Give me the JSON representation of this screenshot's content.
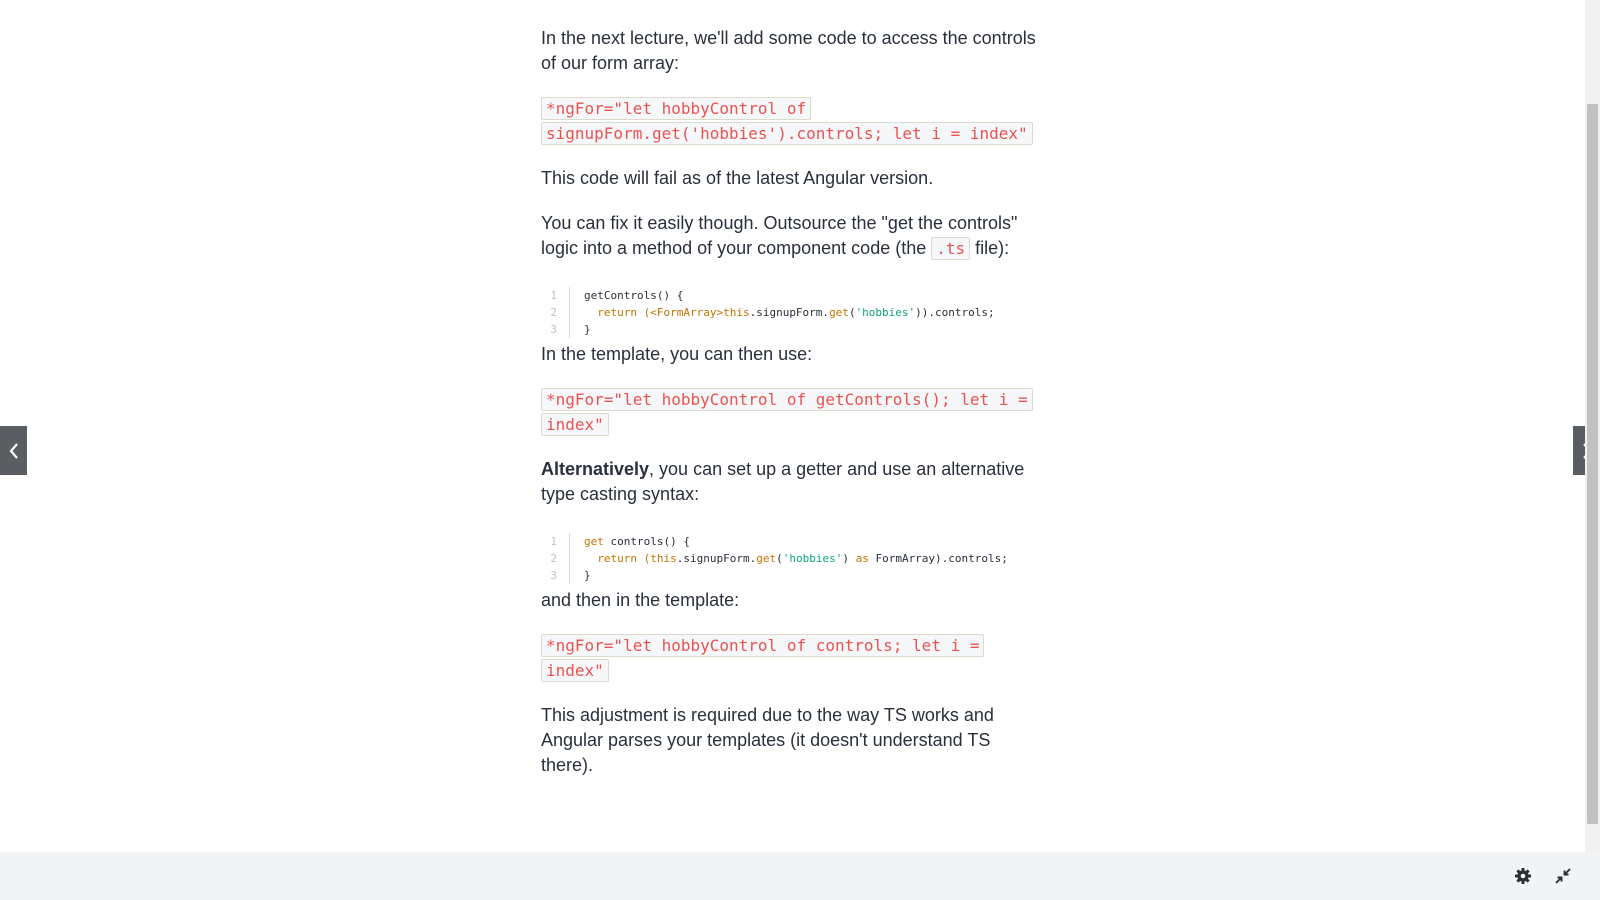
{
  "article": {
    "p1": "In the next lecture, we'll add some code to access the controls of our form array:",
    "code1": "*ngFor=\"let hobbyControl of signupForm.get('hobbies').controls; let i = index\"",
    "p2": "This code will fail as of the latest Angular version.",
    "p3_before": "You can fix it easily though. Outsource the \"get the controls\" logic into a method of your component code (the ",
    "p3_code": ".ts",
    "p3_after": " file):",
    "block1": {
      "line_numbers": [
        "1",
        "2",
        "3"
      ],
      "line1": "getControls() {",
      "line2_pre": "  return (<FormArray>",
      "line2_this": "this",
      "line2_mid": ".signupForm.",
      "line2_get": "get",
      "line2_open": "(",
      "line2_str": "'hobbies'",
      "line2_post": ")).controls;",
      "line3": "}"
    },
    "p4": "In the template, you can then use:",
    "code2": "*ngFor=\"let hobbyControl of getControls(); let i = index\"",
    "p5_bold": "Alternatively",
    "p5_rest": ", you can set up a getter and use an alternative type casting syntax:",
    "block2": {
      "line_numbers": [
        "1",
        "2",
        "3"
      ],
      "line1_get": "get",
      "line1_rest": " controls() {",
      "line2_pre": "  return (",
      "line2_this": "this",
      "line2_mid": ".signupForm.",
      "line2_get": "get",
      "line2_open": "(",
      "line2_str": "'hobbies'",
      "line2_sp": ") ",
      "line2_as": "as",
      "line2_post": " FormArray).controls;",
      "line3": "}"
    },
    "p6": "and then in the template:",
    "code3": "*ngFor=\"let hobbyControl of controls; let i = index\"",
    "p7": "This adjustment is required due to the way TS works and Angular parses your templates (it doesn't understand TS there)."
  },
  "nav": {
    "prev_icon": "chevron-left-icon",
    "next_icon": "chevron-right-icon"
  },
  "footer": {
    "settings_icon": "gear-icon",
    "exit_fullscreen_icon": "minimize-icon"
  },
  "colors": {
    "inline_code": "#ec5252",
    "keyword": "#c27400",
    "string": "#0fa37f",
    "nav_bg": "#5a5d61",
    "footer_bg": "#f2f3f5"
  }
}
